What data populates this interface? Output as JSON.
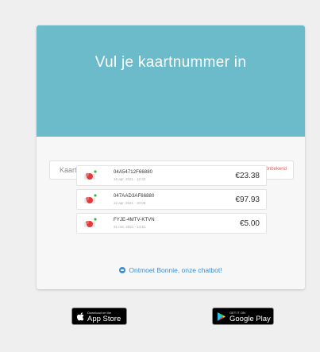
{
  "hero": {
    "title": "Vul je kaartnummer in"
  },
  "input": {
    "placeholder": "Kaartnummer",
    "clear_label": "Onbekend"
  },
  "cards": [
    {
      "code": "04A54712F66880",
      "date": "15 apr. 2021 - 12:32",
      "amount": "€23.38"
    },
    {
      "code": "047AAD3AF66880",
      "date": "12 apr. 2021 - 10:06",
      "amount": "€97.93"
    },
    {
      "code": "FYJE-4MTV-KTVN",
      "date": "31 mrt. 2021 - 14:51",
      "amount": "€5.00"
    }
  ],
  "chatbot": {
    "label": "Ontmoet Bonnie, onze chatbot!"
  },
  "stores": {
    "apple_small": "Download on the",
    "apple_big": "App Store",
    "google_small": "GET IT ON",
    "google_big": "Google Play"
  },
  "colors": {
    "hero": "#6bbbcb",
    "link": "#3a8fd0",
    "clear": "#e05a5a"
  }
}
